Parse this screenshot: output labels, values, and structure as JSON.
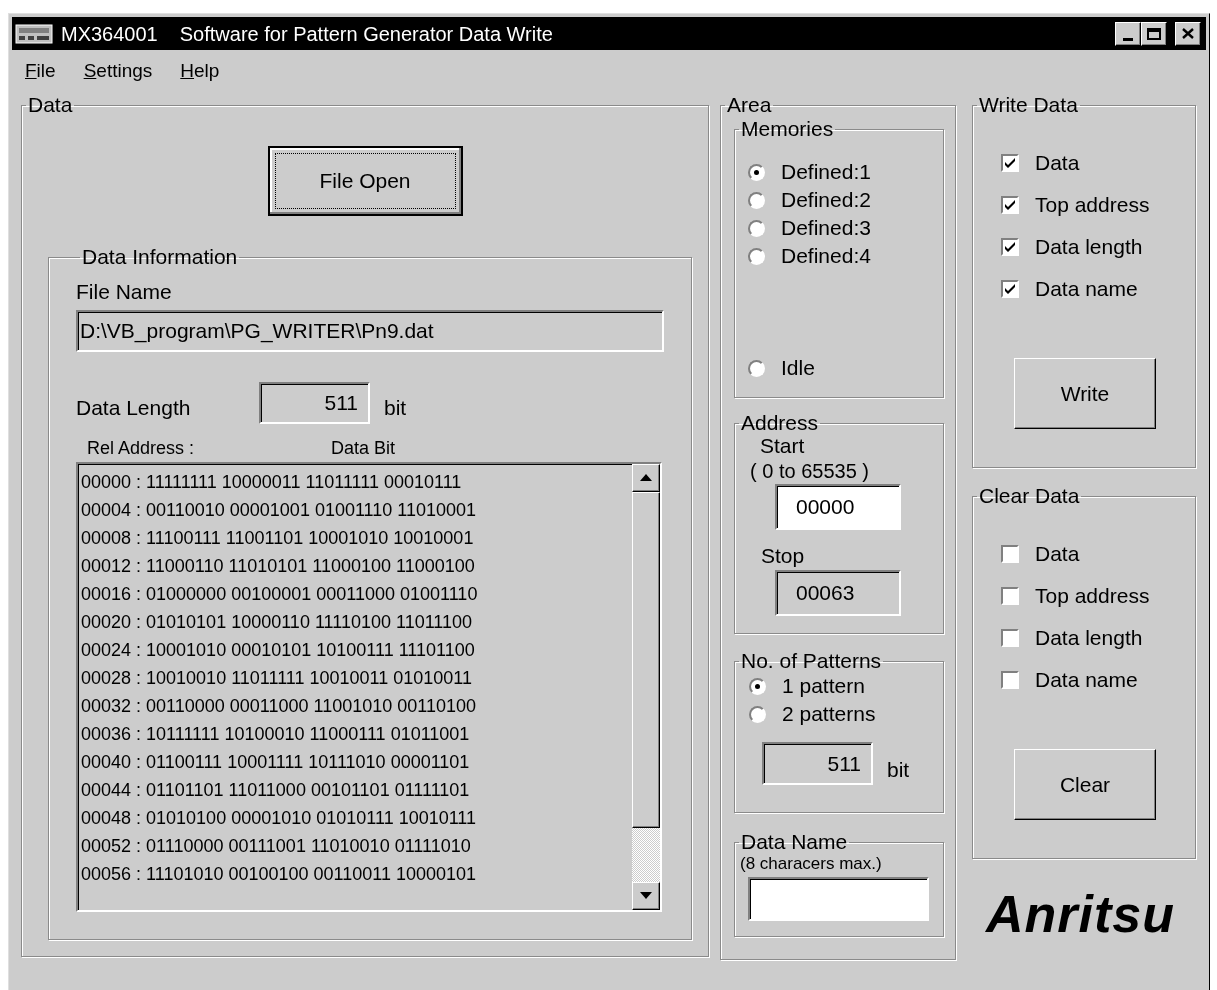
{
  "window": {
    "title_code": "MX364001",
    "title": "Software for Pattern Generator Data Write"
  },
  "menu": [
    {
      "label": "File"
    },
    {
      "label": "Settings"
    },
    {
      "label": "Help"
    }
  ],
  "data": {
    "title": "Data",
    "open_button": "File Open",
    "info": {
      "title": "Data Information",
      "file_name_label": "File Name",
      "file_name": "D:\\VB_program\\PG_WRITER\\Pn9.dat",
      "length_label": "Data Length",
      "length": "511",
      "unit": "bit",
      "headers": [
        "Rel Address :",
        "Data Bit"
      ],
      "rows": [
        "00000 : 11111111 10000011 11011111 00010111",
        "00004 : 00110010 00001001 01001110 11010001",
        "00008 : 11100111 11001101 10001010 10010001",
        "00012 : 11000110 11010101 11000100 11000100",
        "00016 : 01000000 00100001 00011000 01001110",
        "00020 : 01010101 10000110 11110100 11011100",
        "00024 : 10001010 00010101 10100111 11101100",
        "00028 : 10010010 11011111 10010011 01010011",
        "00032 : 00110000 00011000 11001010 00110100",
        "00036 : 10111111 10100010 11000111 01011001",
        "00040 : 01100111 10001111 10111010 00001101",
        "00044 : 01101101 11011000 00101101 01111101",
        "00048 : 01010100 00001010 01010111 10010111",
        "00052 : 01110000 00111001 11010010 01111010",
        "00056 : 11101010 00100100 00110011 10000101"
      ]
    }
  },
  "area": {
    "title": "Area",
    "memories": {
      "title": "Memories",
      "options": [
        {
          "label": "Defined:1",
          "selected": true
        },
        {
          "label": "Defined:2",
          "selected": false
        },
        {
          "label": "Defined:3",
          "selected": false
        },
        {
          "label": "Defined:4",
          "selected": false
        }
      ],
      "idle": {
        "label": "Idle",
        "selected": false
      }
    },
    "address": {
      "title": "Address",
      "start_label": "Start",
      "range": "( 0 to 65535 )",
      "start": "00000",
      "stop_label": "Stop",
      "stop": "00063"
    },
    "patterns": {
      "title": "No. of Patterns",
      "options": [
        {
          "label": "1 pattern",
          "selected": true
        },
        {
          "label": "2 patterns",
          "selected": false
        }
      ],
      "length": "511",
      "unit": "bit"
    },
    "data_name": {
      "title": "Data Name",
      "hint": "(8 characers max.)"
    }
  },
  "write_data": {
    "title": "Write Data",
    "checks": [
      {
        "label": "Data",
        "checked": true
      },
      {
        "label": "Top address",
        "checked": true
      },
      {
        "label": "Data length",
        "checked": true
      },
      {
        "label": "Data name",
        "checked": true
      }
    ],
    "button": "Write"
  },
  "clear_data": {
    "title": "Clear Data",
    "checks": [
      {
        "label": "Data",
        "checked": false
      },
      {
        "label": "Top address",
        "checked": false
      },
      {
        "label": "Data length",
        "checked": false
      },
      {
        "label": "Data name",
        "checked": false
      }
    ],
    "button": "Clear"
  },
  "logo": "Anritsu"
}
